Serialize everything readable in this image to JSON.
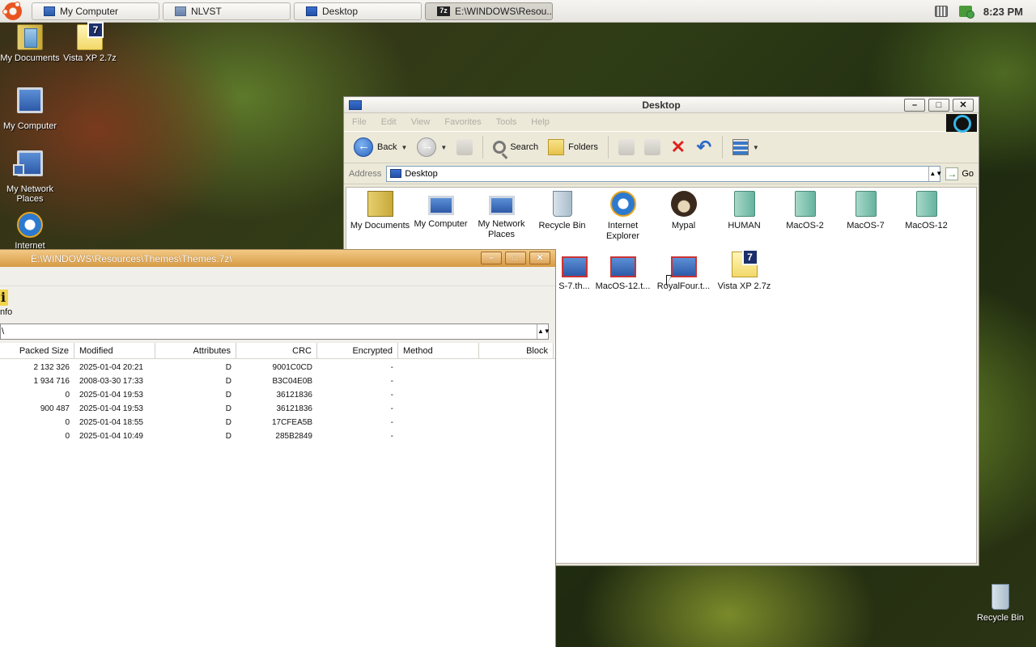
{
  "taskbar": {
    "buttons": [
      {
        "label": "My Computer",
        "icon": "computer-icon"
      },
      {
        "label": "NLVST",
        "icon": "app-icon"
      },
      {
        "label": "Desktop",
        "icon": "desktop-icon"
      },
      {
        "label": "E:\\WINDOWS\\Resou...",
        "icon": "7zip-icon"
      }
    ],
    "clock": "8:23 PM"
  },
  "desktop_icons": [
    {
      "label": "My Documents",
      "icon": "my-documents-icon"
    },
    {
      "label": "Vista XP 2.7z",
      "icon": "7z-archive-icon"
    },
    {
      "label": "My Computer",
      "icon": "my-computer-icon"
    },
    {
      "label": "My Network Places",
      "icon": "network-places-icon"
    },
    {
      "label": "Internet",
      "icon": "internet-explorer-icon"
    },
    {
      "label": "Recycle Bin",
      "icon": "recycle-bin-icon"
    }
  ],
  "explorer": {
    "title": "Desktop",
    "menu": [
      "File",
      "Edit",
      "View",
      "Favorites",
      "Tools",
      "Help"
    ],
    "toolbar": {
      "back": "Back",
      "search": "Search",
      "folders": "Folders"
    },
    "address_label": "Address",
    "address_value": "Desktop",
    "go_label": "Go",
    "items": [
      {
        "label": "My Documents",
        "icon": "my-documents-icon"
      },
      {
        "label": "My Computer",
        "icon": "my-computer-icon"
      },
      {
        "label": "My Network Places",
        "icon": "network-places-icon"
      },
      {
        "label": "Recycle Bin",
        "icon": "recycle-bin-icon"
      },
      {
        "label": "Internet Explorer",
        "icon": "internet-explorer-icon"
      },
      {
        "label": "Mypal",
        "icon": "mypal-icon"
      },
      {
        "label": "HUMAN",
        "icon": "folder-icon"
      },
      {
        "label": "MacOS-2",
        "icon": "folder-icon"
      },
      {
        "label": "MacOS-7",
        "icon": "folder-icon"
      },
      {
        "label": "MacOS-12",
        "icon": "folder-icon"
      },
      {
        "label": "S-7.th...",
        "icon": "theme-file-icon"
      },
      {
        "label": "MacOS-12.t...",
        "icon": "theme-file-icon"
      },
      {
        "label": "RoyalFour.t...",
        "icon": "theme-file-icon"
      },
      {
        "label": "Vista XP 2.7z",
        "icon": "7z-archive-icon"
      }
    ]
  },
  "sevenzip": {
    "title": "E:\\WINDOWS\\Resources\\Themes\\Themes.7z\\",
    "info_label": "nfo",
    "path_value": "\\",
    "columns": [
      "Packed Size",
      "Modified",
      "Attributes",
      "CRC",
      "Encrypted",
      "Method",
      "Block"
    ],
    "rows": [
      {
        "packed": "2 132 326",
        "modified": "2025-01-04 20:21",
        "attr": "D",
        "crc": "9001C0CD",
        "enc": "-"
      },
      {
        "packed": "1 934 716",
        "modified": "2008-03-30 17:33",
        "attr": "D",
        "crc": "B3C04E0B",
        "enc": "-"
      },
      {
        "packed": "0",
        "modified": "2025-01-04 19:53",
        "attr": "D",
        "crc": "36121836",
        "enc": "-"
      },
      {
        "packed": "900 487",
        "modified": "2025-01-04 19:53",
        "attr": "D",
        "crc": "36121836",
        "enc": "-"
      },
      {
        "packed": "0",
        "modified": "2025-01-04 18:55",
        "attr": "D",
        "crc": "17CFEA5B",
        "enc": "-"
      },
      {
        "packed": "0",
        "modified": "2025-01-04 10:49",
        "attr": "D",
        "crc": "285B2849",
        "enc": "-"
      }
    ]
  }
}
